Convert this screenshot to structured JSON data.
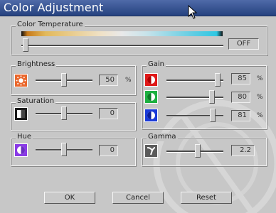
{
  "window": {
    "title": "Color Adjustment"
  },
  "color_temperature": {
    "label": "Color Temperature",
    "value": "OFF",
    "slider_position": 0.0
  },
  "brightness": {
    "label": "Brightness",
    "value": "50",
    "unit": "%",
    "slider_position": 0.5,
    "icon": "brightness-icon"
  },
  "saturation": {
    "label": "Saturation",
    "value": "0",
    "slider_position": 0.5,
    "icon": "saturation-icon"
  },
  "hue": {
    "label": "Hue",
    "value": "0",
    "slider_position": 0.5,
    "icon": "hue-icon"
  },
  "gain": {
    "label": "Gain",
    "channels": [
      {
        "name": "red",
        "value": "85",
        "unit": "%",
        "color": "#e01818",
        "slider_position": 0.85
      },
      {
        "name": "green",
        "value": "80",
        "unit": "%",
        "color": "#1cb040",
        "slider_position": 0.8
      },
      {
        "name": "blue",
        "value": "81",
        "unit": "%",
        "color": "#1a3ad8",
        "slider_position": 0.81
      }
    ]
  },
  "gamma": {
    "label": "Gamma",
    "value": "2.2",
    "slider_position": 0.55,
    "icon": "gamma-icon"
  },
  "buttons": {
    "ok": "OK",
    "cancel": "Cancel",
    "reset": "Reset"
  }
}
